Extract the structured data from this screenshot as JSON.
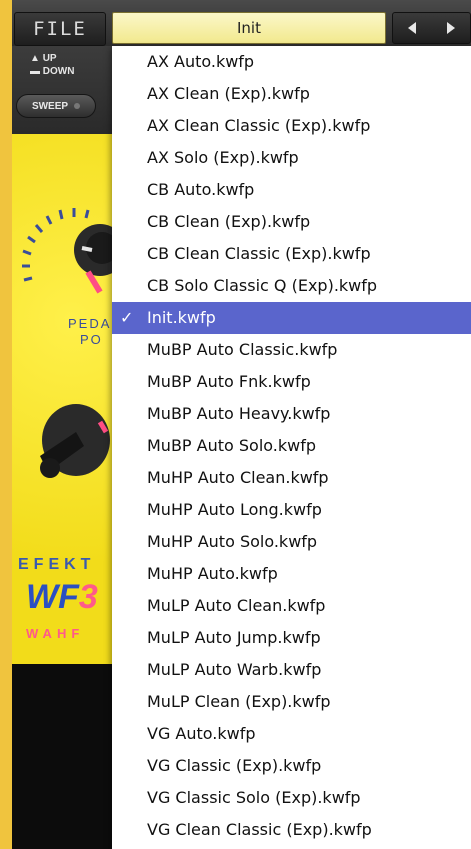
{
  "toolbar": {
    "file_label": "FILE",
    "preset_name": "Init",
    "up_label": "UP",
    "down_label": "DOWN",
    "sweep_label": "SWEEP"
  },
  "nav_icons": [
    "left-arrow-icon",
    "right-arrow-icon"
  ],
  "panel": {
    "pedal_label_1": "PEDAL",
    "pedal_label_2": "PO",
    "brand": "EFEKT",
    "model": "WF",
    "model_suffix": "3",
    "product_type": "WAHF"
  },
  "menu": {
    "checkmark": "✓",
    "selected_index": 8,
    "items": [
      "AX Auto.kwfp",
      "AX Clean (Exp).kwfp",
      "AX Clean Classic (Exp).kwfp",
      "AX Solo (Exp).kwfp",
      "CB Auto.kwfp",
      "CB Clean (Exp).kwfp",
      "CB Clean Classic (Exp).kwfp",
      "CB Solo Classic Q (Exp).kwfp",
      "Init.kwfp",
      "MuBP Auto Classic.kwfp",
      "MuBP Auto Fnk.kwfp",
      "MuBP Auto Heavy.kwfp",
      "MuBP Auto Solo.kwfp",
      "MuHP Auto Clean.kwfp",
      "MuHP Auto Long.kwfp",
      "MuHP Auto Solo.kwfp",
      "MuHP Auto.kwfp",
      "MuLP Auto Clean.kwfp",
      "MuLP Auto Jump.kwfp",
      "MuLP Auto Warb.kwfp",
      "MuLP Clean (Exp).kwfp",
      "VG Auto.kwfp",
      "VG Classic (Exp).kwfp",
      "VG Classic Solo (Exp).kwfp",
      "VG Clean Classic (Exp).kwfp"
    ]
  },
  "colors": {
    "selection": "#5a65cc",
    "preset_field": "#f6efa8",
    "panel_yellow": "#f2dc1a",
    "accent_blue": "#2b4fc2",
    "accent_pink": "#ff5a8a"
  }
}
